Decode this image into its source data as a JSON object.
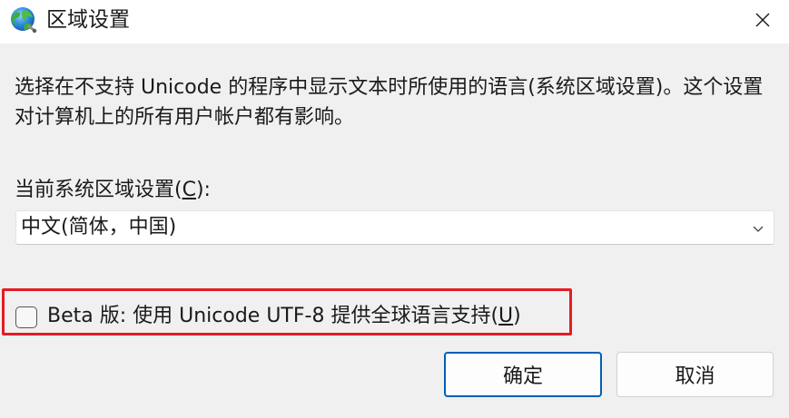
{
  "window": {
    "title": "区域设置",
    "icon": "globe-icon",
    "close_icon": "close-icon"
  },
  "description": "选择在不支持 Unicode 的程序中显示文本时所使用的语言(系统区域设置)。这个设置对计算机上的所有用户帐户都有影响。",
  "locale": {
    "label_before": "当前系统区域设置(",
    "label_accel": "C",
    "label_after": "):",
    "selected_value": "中文(简体，中国)",
    "dropdown_icon": "chevron-down-icon"
  },
  "utf8_option": {
    "checked": false,
    "label_before": "Beta 版: 使用 Unicode UTF-8 提供全球语言支持(",
    "label_accel": "U",
    "label_after": ")",
    "highlight_color": "#e51c23"
  },
  "buttons": {
    "ok_label": "确定",
    "cancel_label": "取消"
  },
  "colors": {
    "accent": "#005fb8",
    "highlight": "#e51c23"
  }
}
